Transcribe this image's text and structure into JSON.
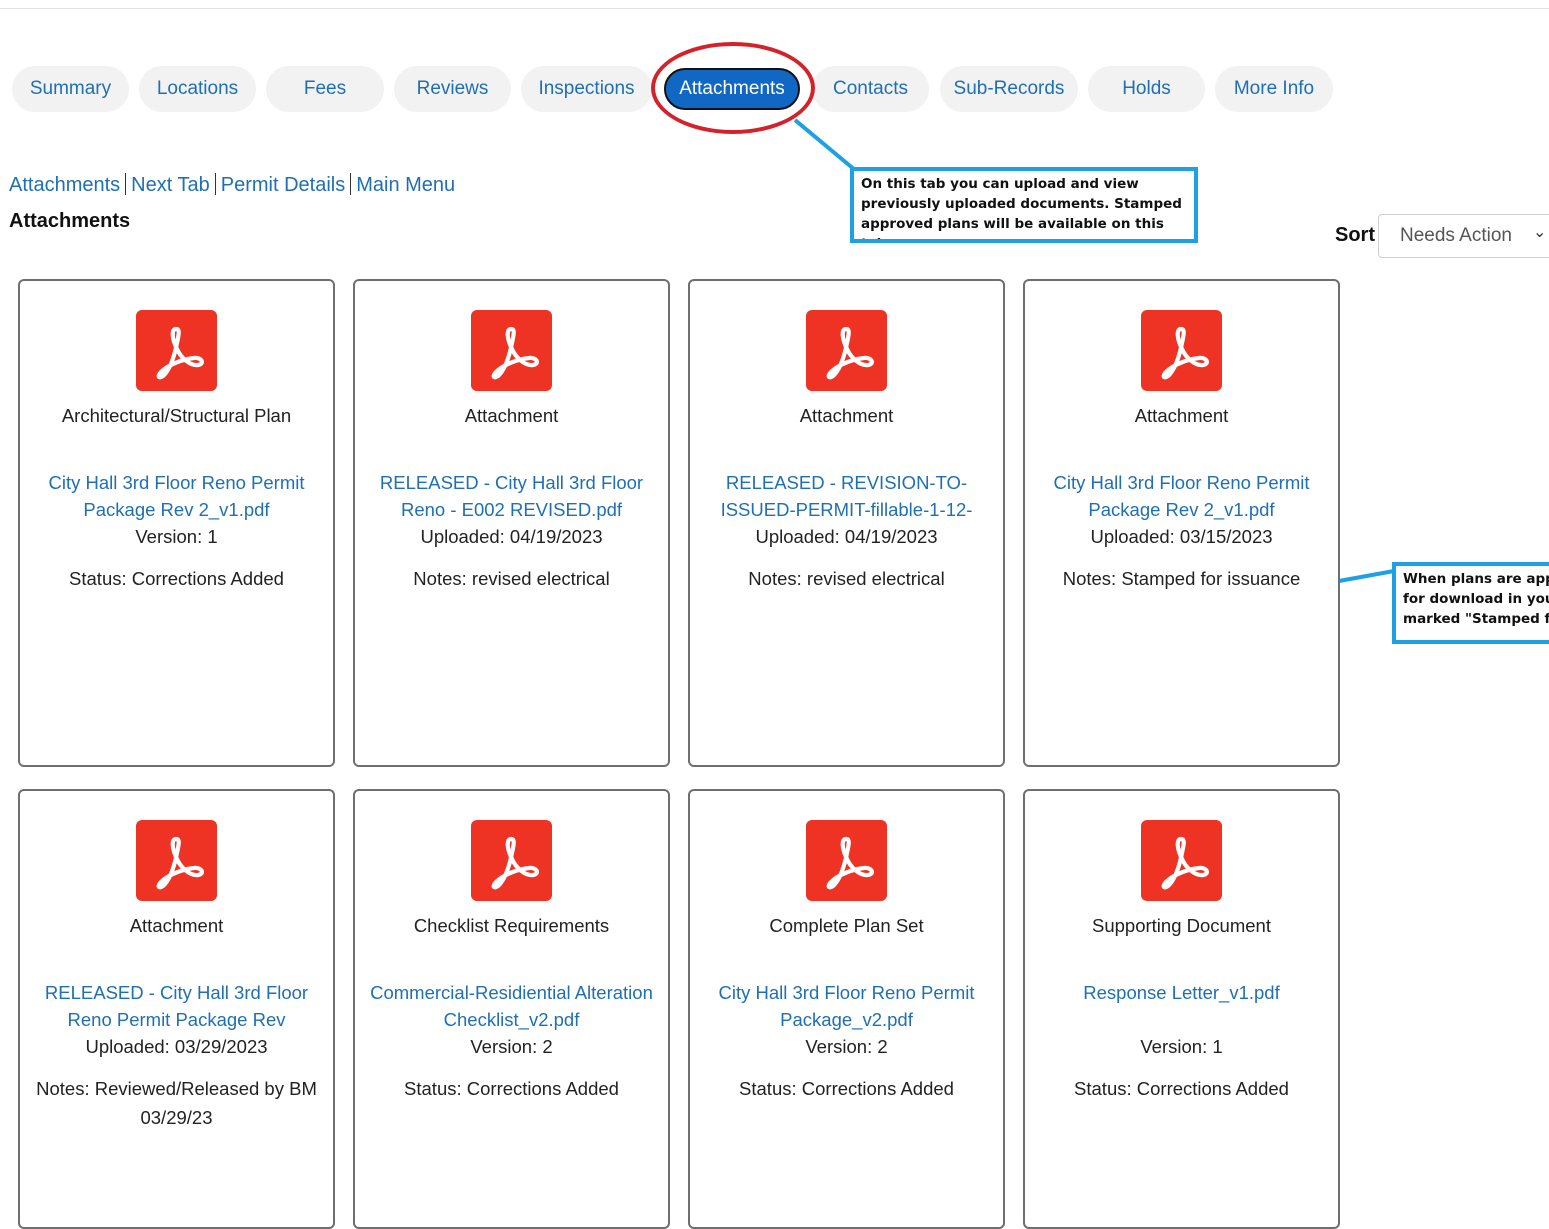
{
  "tabs": [
    {
      "label": "Summary"
    },
    {
      "label": "Locations"
    },
    {
      "label": "Fees"
    },
    {
      "label": "Reviews"
    },
    {
      "label": "Inspections"
    },
    {
      "label": "Attachments"
    },
    {
      "label": "Contacts"
    },
    {
      "label": "Sub-Records"
    },
    {
      "label": "Holds"
    },
    {
      "label": "More Info"
    }
  ],
  "breadcrumb": {
    "attachments": "Attachments",
    "next_tab": "Next Tab",
    "permit_details": "Permit Details",
    "main_menu": "Main Menu"
  },
  "section_title": "Attachments",
  "callouts": {
    "tab_note": "On this tab you can upload and view previously uploaded documents. Stamped approved plans will be available on this tab.",
    "plans_note_line1": "When plans are app",
    "plans_note_line2": "for download in you",
    "plans_note_line3": "marked \"Stamped fo"
  },
  "sort": {
    "label": "Sort",
    "selected": "Needs Action"
  },
  "cards": [
    {
      "type": "Architectural/Structural Plan",
      "file": "City Hall 3rd Floor Reno Permit Package Rev 2_v1.pdf",
      "meta": "Version: 1",
      "extra": "Status: Corrections Added"
    },
    {
      "type": "Attachment",
      "file": "RELEASED - City Hall 3rd Floor Reno - E002 REVISED.pdf",
      "meta": "Uploaded: 04/19/2023",
      "extra": "Notes: revised electrical"
    },
    {
      "type": "Attachment",
      "file": "RELEASED - REVISION-TO-ISSUED-PERMIT-fillable-1-12-",
      "meta": "Uploaded: 04/19/2023",
      "extra": "Notes: revised electrical"
    },
    {
      "type": "Attachment",
      "file": "City Hall 3rd Floor Reno Permit Package Rev 2_v1.pdf",
      "meta": "Uploaded: 03/15/2023",
      "extra": "Notes: Stamped for issuance"
    },
    {
      "type": "Attachment",
      "file": "RELEASED - City Hall 3rd Floor Reno Permit Package Rev",
      "meta": "Uploaded: 03/29/2023",
      "extra": "Notes: Reviewed/Released by BM 03/29/23"
    },
    {
      "type": "Checklist Requirements",
      "file": "Commercial-Residiential Alteration Checklist_v2.pdf",
      "meta": "Version: 2",
      "extra": "Status: Corrections Added"
    },
    {
      "type": "Complete Plan Set",
      "file": "City Hall 3rd Floor Reno Permit Package_v2.pdf",
      "meta": "Version: 2",
      "extra": "Status: Corrections Added"
    },
    {
      "type": "Supporting Document",
      "file": "Response Letter_v1.pdf",
      "meta": "Version: 1",
      "extra": "Status: Corrections Added"
    }
  ]
}
